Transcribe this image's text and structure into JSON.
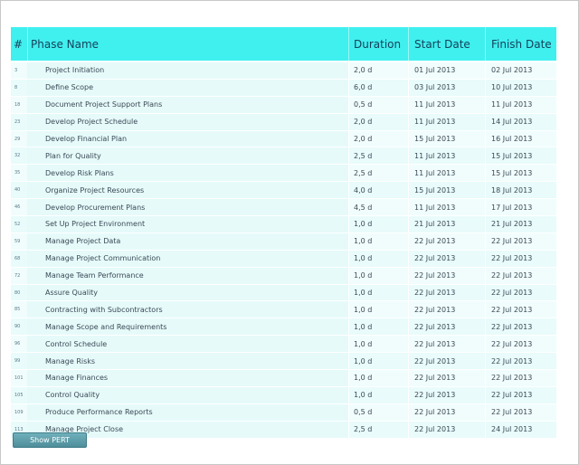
{
  "header": {
    "num": "#",
    "name": "Phase Name",
    "duration": "Duration",
    "start": "Start Date",
    "finish": "Finish Date"
  },
  "rows": [
    {
      "num": "3",
      "name": "Project Initiation",
      "duration": "2,0 d",
      "start": "01 Jul 2013",
      "finish": "02 Jul 2013"
    },
    {
      "num": "8",
      "name": "Define Scope",
      "duration": "6,0 d",
      "start": "03 Jul 2013",
      "finish": "10 Jul 2013"
    },
    {
      "num": "18",
      "name": "Document Project Support Plans",
      "duration": "0,5 d",
      "start": "11 Jul 2013",
      "finish": "11 Jul 2013"
    },
    {
      "num": "23",
      "name": "Develop Project Schedule",
      "duration": "2,0 d",
      "start": "11 Jul 2013",
      "finish": "14 Jul 2013"
    },
    {
      "num": "29",
      "name": "Develop Financial Plan",
      "duration": "2,0 d",
      "start": "15 Jul 2013",
      "finish": "16 Jul 2013"
    },
    {
      "num": "32",
      "name": "Plan for Quality",
      "duration": "2,5 d",
      "start": "11 Jul 2013",
      "finish": "15 Jul 2013"
    },
    {
      "num": "35",
      "name": "Develop Risk Plans",
      "duration": "2,5 d",
      "start": "11 Jul 2013",
      "finish": "15 Jul 2013"
    },
    {
      "num": "40",
      "name": "Organize Project Resources",
      "duration": "4,0 d",
      "start": "15 Jul 2013",
      "finish": "18 Jul 2013"
    },
    {
      "num": "46",
      "name": "Develop Procurement Plans",
      "duration": "4,5 d",
      "start": "11 Jul 2013",
      "finish": "17 Jul 2013"
    },
    {
      "num": "52",
      "name": "Set Up Project Environment",
      "duration": "1,0 d",
      "start": "21 Jul 2013",
      "finish": "21 Jul 2013"
    },
    {
      "num": "59",
      "name": "Manage Project Data",
      "duration": "1,0 d",
      "start": "22 Jul 2013",
      "finish": "22 Jul 2013"
    },
    {
      "num": "68",
      "name": "Manage Project Communication",
      "duration": "1,0 d",
      "start": "22 Jul 2013",
      "finish": "22 Jul 2013"
    },
    {
      "num": "72",
      "name": "Manage Team Performance",
      "duration": "1,0 d",
      "start": "22 Jul 2013",
      "finish": "22 Jul 2013"
    },
    {
      "num": "80",
      "name": "Assure Quality",
      "duration": "1,0 d",
      "start": "22 Jul 2013",
      "finish": "22 Jul 2013"
    },
    {
      "num": "85",
      "name": "Contracting with Subcontractors",
      "duration": "1,0 d",
      "start": "22 Jul 2013",
      "finish": "22 Jul 2013"
    },
    {
      "num": "90",
      "name": "Manage Scope and Requirements",
      "duration": "1,0 d",
      "start": "22 Jul 2013",
      "finish": "22 Jul 2013"
    },
    {
      "num": "96",
      "name": "Control Schedule",
      "duration": "1,0 d",
      "start": "22 Jul 2013",
      "finish": "22 Jul 2013"
    },
    {
      "num": "99",
      "name": "Manage Risks",
      "duration": "1,0 d",
      "start": "22 Jul 2013",
      "finish": "22 Jul 2013"
    },
    {
      "num": "101",
      "name": "Manage Finances",
      "duration": "1,0 d",
      "start": "22 Jul 2013",
      "finish": "22 Jul 2013"
    },
    {
      "num": "105",
      "name": "Control Quality",
      "duration": "1,0 d",
      "start": "22 Jul 2013",
      "finish": "22 Jul 2013"
    },
    {
      "num": "109",
      "name": "Produce Performance Reports",
      "duration": "0,5 d",
      "start": "22 Jul 2013",
      "finish": "22 Jul 2013"
    },
    {
      "num": "113",
      "name": "Manage Project Close",
      "duration": "2,5 d",
      "start": "22 Jul 2013",
      "finish": "24 Jul 2013"
    }
  ],
  "button": {
    "label": "Show PERT"
  },
  "colors": {
    "header_bg": "#3ff0ef",
    "row_bg": "#e9fbfb",
    "button_bg": "#5f9fab"
  }
}
